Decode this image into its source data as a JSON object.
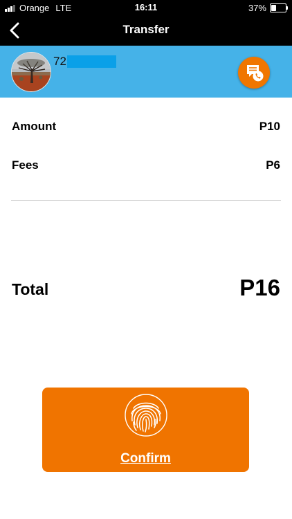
{
  "status_bar": {
    "carrier": "Orange",
    "network": "LTE",
    "time": "16:11",
    "battery_percent": "37%",
    "battery_level": 0.37,
    "signal_bars": 3,
    "signal_max": 4
  },
  "nav": {
    "title": "Transfer",
    "back_icon": "chevron-left-icon"
  },
  "recipient": {
    "number_prefix": "72",
    "number_redacted": true,
    "contact_icon": "message-phone-icon",
    "band_color": "#45b2e8"
  },
  "details": {
    "amount_label": "Amount",
    "amount_value": "P10",
    "fees_label": "Fees",
    "fees_value": "P6"
  },
  "total": {
    "label": "Total",
    "value": "P16"
  },
  "confirm": {
    "label": "Confirm",
    "icon": "fingerprint-icon",
    "color": "#f07400"
  }
}
